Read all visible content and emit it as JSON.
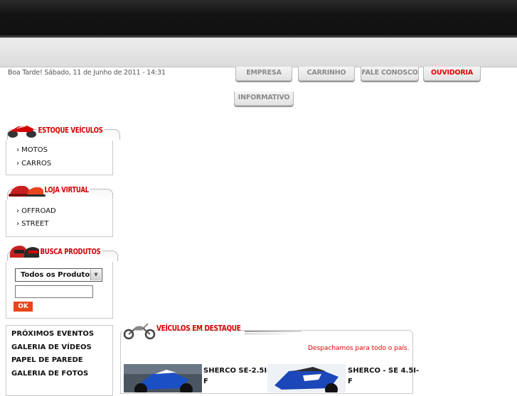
{
  "header": {
    "greeting": "Boa Tarde! Sábado, 11 de Junho de 2011 - 14:31"
  },
  "nav": {
    "tabs": [
      {
        "label": "EMPRESA"
      },
      {
        "label": "CARRINHO"
      },
      {
        "label": "FALE CONOSCO"
      },
      {
        "label": "OUVIDORIA",
        "active": true
      },
      {
        "label": "INFORMATIVO"
      }
    ]
  },
  "estoque": {
    "title": "ESTOQUE VEÍCULOS",
    "items": [
      {
        "label": "› MOTOS"
      },
      {
        "label": "› CARROS"
      }
    ]
  },
  "loja": {
    "title": "LOJA VIRTUAL",
    "items": [
      {
        "label": "› OFFROAD"
      },
      {
        "label": "› STREET"
      }
    ]
  },
  "busca": {
    "title": "BUSCA PRODUTOS",
    "select_value": "Todos os Produtos",
    "input_value": "",
    "ok_label": "OK"
  },
  "links": [
    {
      "label": "PRÓXIMOS EVENTOS"
    },
    {
      "label": "GALERIA DE VÍDEOS"
    },
    {
      "label": "PAPEL DE PAREDE"
    },
    {
      "label": "GALERIA DE FOTOS"
    }
  ],
  "featured": {
    "title": "VEÍCULOS EM DESTAQUE",
    "dispatch_note": "Despachamos para todo o país.",
    "products": [
      {
        "name_line1": "SHERCO SE-2.5I-",
        "name_line2": "F"
      },
      {
        "name_line1": "SHERCO - SE 4.5I-",
        "name_line2": "F"
      }
    ]
  },
  "colors": {
    "accent_red": "#d40000",
    "ok_button": "#e8451c",
    "topbar": "#141414"
  }
}
